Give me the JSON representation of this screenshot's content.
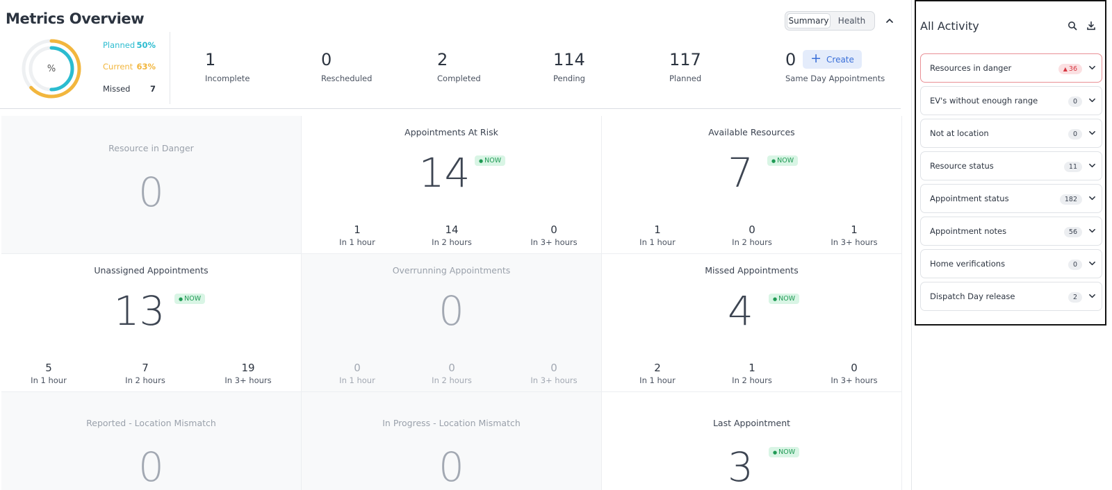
{
  "header": {
    "title": "Metrics Overview",
    "toggle": [
      "Summary",
      "Health"
    ],
    "collapse_icon": "chevron-up-icon"
  },
  "donut": {
    "center_label": "%",
    "planned_pct": 50,
    "current_pct": 63,
    "planned_color": "#2bbcd0",
    "current_color": "#f2b63d",
    "legend": [
      {
        "label": "Planned",
        "value": "50%"
      },
      {
        "label": "Current",
        "value": "63%"
      },
      {
        "label": "Missed",
        "value": "7"
      }
    ]
  },
  "stats": [
    {
      "value": "1",
      "label": "Incomplete"
    },
    {
      "value": "0",
      "label": "Rescheduled"
    },
    {
      "value": "2",
      "label": "Completed"
    },
    {
      "value": "114",
      "label": "Pending"
    },
    {
      "value": "117",
      "label": "Planned"
    },
    {
      "value": "0",
      "label": "Same Day Appointments"
    }
  ],
  "create_button": {
    "label": "Create",
    "icon": "plus-icon"
  },
  "cards": [
    {
      "title": "Resource in Danger",
      "value": "0"
    },
    {
      "title": "Appointments At Risk",
      "value": "14",
      "badge": "NOW",
      "subs": [
        {
          "value": "1",
          "label": "In 1 hour"
        },
        {
          "value": "14",
          "label": "In 2 hours"
        },
        {
          "value": "0",
          "label": "In 3+ hours"
        }
      ]
    },
    {
      "title": "Available Resources",
      "value": "7",
      "badge": "NOW",
      "subs": [
        {
          "value": "1",
          "label": "In 1 hour"
        },
        {
          "value": "0",
          "label": "In 2 hours"
        },
        {
          "value": "1",
          "label": "In 3+ hours"
        }
      ]
    },
    {
      "title": "Unassigned Appointments",
      "value": "13",
      "badge": "NOW",
      "subs": [
        {
          "value": "5",
          "label": "In 1 hour"
        },
        {
          "value": "7",
          "label": "In 2 hours"
        },
        {
          "value": "19",
          "label": "In 3+ hours"
        }
      ]
    },
    {
      "title": "Overrunning Appointments",
      "value": "0",
      "subs": [
        {
          "value": "0",
          "label": "In 1 hour"
        },
        {
          "value": "0",
          "label": "In 2 hours"
        },
        {
          "value": "0",
          "label": "In 3+ hours"
        }
      ]
    },
    {
      "title": "Missed Appointments",
      "value": "4",
      "badge": "NOW",
      "subs": [
        {
          "value": "2",
          "label": "In 1 hour"
        },
        {
          "value": "1",
          "label": "In 2 hours"
        },
        {
          "value": "0",
          "label": "In 3+ hours"
        }
      ]
    },
    {
      "title": "Reported - Location Mismatch",
      "value": "0"
    },
    {
      "title": "In Progress - Location Mismatch",
      "value": "0"
    },
    {
      "title": "Last Appointment",
      "value": "3",
      "badge": "NOW"
    }
  ],
  "activity": {
    "title": "All Activity",
    "icons": [
      "search-icon",
      "download-icon"
    ],
    "items": [
      {
        "label": "Resources in danger",
        "count": "36",
        "status": "danger"
      },
      {
        "label": "EV's without enough range",
        "count": "0"
      },
      {
        "label": "Not at location",
        "count": "0"
      },
      {
        "label": "Resource status",
        "count": "11"
      },
      {
        "label": "Appointment status",
        "count": "182"
      },
      {
        "label": "Appointment notes",
        "count": "56"
      },
      {
        "label": "Home verifications",
        "count": "0"
      },
      {
        "label": "Dispatch Day release",
        "count": "2"
      }
    ]
  }
}
